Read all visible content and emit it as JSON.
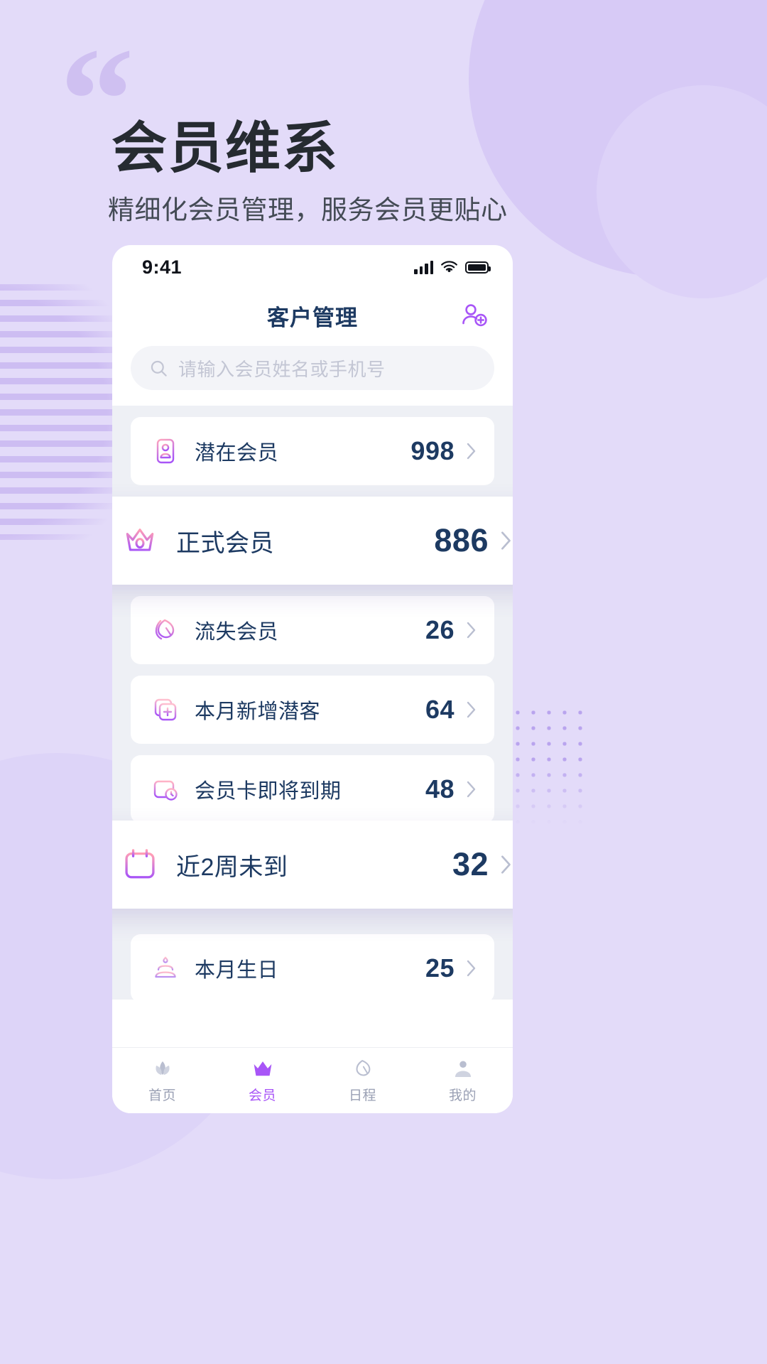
{
  "promo": {
    "quote_mark": "“",
    "title": "会员维系",
    "subtitle": "精细化会员管理，服务会员更贴心",
    "bg_color": "#e3dbf9",
    "title_color": "#262b31",
    "accent_color": "#a855f7"
  },
  "phone": {
    "status": {
      "time": "9:41",
      "signal_icon": "cellular-signal-icon",
      "wifi_icon": "wifi-icon",
      "battery_icon": "battery-full-icon"
    },
    "appbar": {
      "title": "客户管理",
      "add_icon": "add-user-icon"
    },
    "search": {
      "placeholder": "请输入会员姓名或手机号",
      "icon": "search-icon"
    },
    "list": [
      {
        "icon": "contact-card-icon",
        "label": "潜在会员",
        "value": "998",
        "highlighted": false
      },
      {
        "icon": "crown-icon",
        "label": "正式会员",
        "value": "886",
        "highlighted": true
      },
      {
        "icon": "leaf-icon",
        "label": "流失会员",
        "value": "26",
        "highlighted": false
      },
      {
        "icon": "add-card-icon",
        "label": "本月新增潜客",
        "value": "64",
        "highlighted": false
      },
      {
        "icon": "card-clock-icon",
        "label": "会员卡即将到期",
        "value": "48",
        "highlighted": false
      },
      {
        "icon": "calendar-icon",
        "label": "近2周未到",
        "value": "32",
        "highlighted": true
      },
      {
        "icon": "birthday-cake-icon",
        "label": "本月生日",
        "value": "25",
        "highlighted": false
      }
    ],
    "chevron": "›",
    "tabs": [
      {
        "icon": "lotus-icon",
        "label": "首页",
        "active": false
      },
      {
        "icon": "crown-icon",
        "label": "会员",
        "active": true
      },
      {
        "icon": "leaf-icon",
        "label": "日程",
        "active": false
      },
      {
        "icon": "person-icon",
        "label": "我的",
        "active": false
      }
    ]
  }
}
